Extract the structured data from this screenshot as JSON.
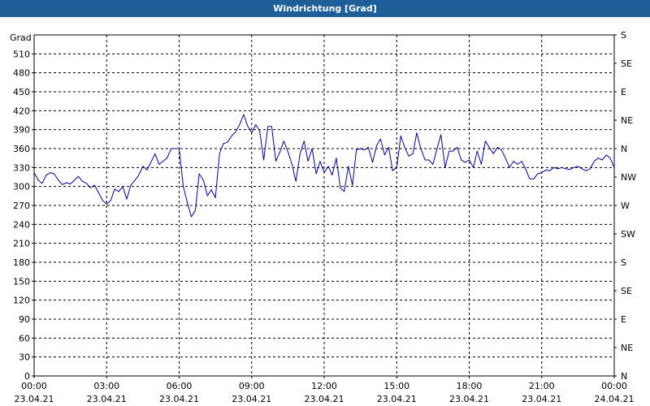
{
  "window": {
    "title": "Windrichtung [Grad]"
  },
  "chart_data": {
    "type": "line",
    "title": "Windrichtung [Grad]",
    "ylabel": "Grad",
    "ylim": [
      0,
      540
    ],
    "yticks": [
      0,
      30,
      60,
      90,
      120,
      150,
      180,
      210,
      240,
      270,
      300,
      330,
      360,
      390,
      420,
      450,
      480,
      510
    ],
    "y2ticks": [
      "N",
      "NE",
      "E",
      "SE",
      "S",
      "SW",
      "W",
      "NW",
      "N",
      "NE",
      "E",
      "SE",
      "S"
    ],
    "xlim": [
      0,
      24
    ],
    "xticks": [
      {
        "time": "00:00",
        "date": "23.04.21"
      },
      {
        "time": "03:00",
        "date": "23.04.21"
      },
      {
        "time": "06:00",
        "date": "23.04.21"
      },
      {
        "time": "09:00",
        "date": "23.04.21"
      },
      {
        "time": "12:00",
        "date": "23.04.21"
      },
      {
        "time": "15:00",
        "date": "23.04.21"
      },
      {
        "time": "18:00",
        "date": "23.04.21"
      },
      {
        "time": "21:00",
        "date": "23.04.21"
      },
      {
        "time": "00:00",
        "date": "24.04.21"
      }
    ],
    "grid": true,
    "color": "#00008b",
    "series": [
      {
        "points": [
          [
            0.0,
            322
          ],
          [
            0.17,
            310
          ],
          [
            0.33,
            305
          ],
          [
            0.5,
            318
          ],
          [
            0.67,
            322
          ],
          [
            0.83,
            320
          ],
          [
            1.0,
            310
          ],
          [
            1.17,
            303
          ],
          [
            1.33,
            306
          ],
          [
            1.5,
            304
          ],
          [
            1.67,
            310
          ],
          [
            1.83,
            316
          ],
          [
            2.0,
            308
          ],
          [
            2.17,
            305
          ],
          [
            2.33,
            298
          ],
          [
            2.5,
            302
          ],
          [
            2.67,
            290
          ],
          [
            2.83,
            278
          ],
          [
            3.0,
            272
          ],
          [
            3.17,
            278
          ],
          [
            3.33,
            296
          ],
          [
            3.5,
            292
          ],
          [
            3.67,
            300
          ],
          [
            3.83,
            280
          ],
          [
            4.0,
            302
          ],
          [
            4.17,
            310
          ],
          [
            4.33,
            318
          ],
          [
            4.5,
            332
          ],
          [
            4.67,
            326
          ],
          [
            4.83,
            338
          ],
          [
            5.0,
            352
          ],
          [
            5.17,
            335
          ],
          [
            5.33,
            340
          ],
          [
            5.5,
            345
          ],
          [
            5.67,
            360
          ],
          [
            5.83,
            360
          ],
          [
            6.0,
            360
          ],
          [
            6.17,
            300
          ],
          [
            6.33,
            276
          ],
          [
            6.5,
            252
          ],
          [
            6.67,
            262
          ],
          [
            6.83,
            320
          ],
          [
            7.0,
            310
          ],
          [
            7.17,
            285
          ],
          [
            7.33,
            295
          ],
          [
            7.5,
            282
          ],
          [
            7.67,
            352
          ],
          [
            7.83,
            368
          ],
          [
            8.0,
            370
          ],
          [
            8.17,
            380
          ],
          [
            8.33,
            386
          ],
          [
            8.5,
            398
          ],
          [
            8.67,
            414
          ],
          [
            8.83,
            396
          ],
          [
            9.0,
            385
          ],
          [
            9.17,
            398
          ],
          [
            9.33,
            388
          ],
          [
            9.5,
            342
          ],
          [
            9.67,
            395
          ],
          [
            9.83,
            395
          ],
          [
            10.0,
            340
          ],
          [
            10.17,
            355
          ],
          [
            10.33,
            372
          ],
          [
            10.5,
            355
          ],
          [
            10.67,
            335
          ],
          [
            10.83,
            308
          ],
          [
            11.0,
            352
          ],
          [
            11.17,
            372
          ],
          [
            11.33,
            340
          ],
          [
            11.5,
            360
          ],
          [
            11.67,
            320
          ],
          [
            11.83,
            340
          ],
          [
            12.0,
            322
          ],
          [
            12.17,
            332
          ],
          [
            12.33,
            318
          ],
          [
            12.5,
            345
          ],
          [
            12.67,
            298
          ],
          [
            12.83,
            292
          ],
          [
            13.0,
            332
          ],
          [
            13.17,
            302
          ],
          [
            13.33,
            358
          ],
          [
            13.5,
            360
          ],
          [
            13.67,
            358
          ],
          [
            13.83,
            362
          ],
          [
            14.0,
            338
          ],
          [
            14.17,
            365
          ],
          [
            14.33,
            375
          ],
          [
            14.5,
            350
          ],
          [
            14.67,
            362
          ],
          [
            14.83,
            325
          ],
          [
            15.0,
            330
          ],
          [
            15.17,
            380
          ],
          [
            15.33,
            362
          ],
          [
            15.5,
            348
          ],
          [
            15.67,
            352
          ],
          [
            15.83,
            385
          ],
          [
            16.0,
            360
          ],
          [
            16.17,
            342
          ],
          [
            16.33,
            342
          ],
          [
            16.5,
            335
          ],
          [
            16.67,
            360
          ],
          [
            16.83,
            382
          ],
          [
            17.0,
            330
          ],
          [
            17.17,
            356
          ],
          [
            17.33,
            356
          ],
          [
            17.5,
            362
          ],
          [
            17.67,
            342
          ],
          [
            17.83,
            338
          ],
          [
            18.0,
            342
          ],
          [
            18.17,
            330
          ],
          [
            18.33,
            356
          ],
          [
            18.5,
            335
          ],
          [
            18.67,
            372
          ],
          [
            18.83,
            362
          ],
          [
            19.0,
            352
          ],
          [
            19.17,
            362
          ],
          [
            19.33,
            358
          ],
          [
            19.5,
            345
          ],
          [
            19.67,
            330
          ],
          [
            19.83,
            340
          ],
          [
            20.0,
            335
          ],
          [
            20.17,
            340
          ],
          [
            20.33,
            328
          ],
          [
            20.5,
            312
          ],
          [
            20.67,
            312
          ],
          [
            20.83,
            320
          ],
          [
            21.0,
            322
          ],
          [
            21.17,
            326
          ],
          [
            21.33,
            325
          ],
          [
            21.5,
            330
          ],
          [
            21.67,
            328
          ],
          [
            21.83,
            330
          ],
          [
            22.0,
            328
          ],
          [
            22.17,
            327
          ],
          [
            22.33,
            330
          ],
          [
            22.5,
            332
          ],
          [
            22.67,
            328
          ],
          [
            22.83,
            325
          ],
          [
            23.0,
            328
          ],
          [
            23.17,
            340
          ],
          [
            23.33,
            345
          ],
          [
            23.5,
            342
          ],
          [
            23.67,
            350
          ],
          [
            23.83,
            345
          ],
          [
            24.0,
            330
          ]
        ]
      }
    ]
  }
}
